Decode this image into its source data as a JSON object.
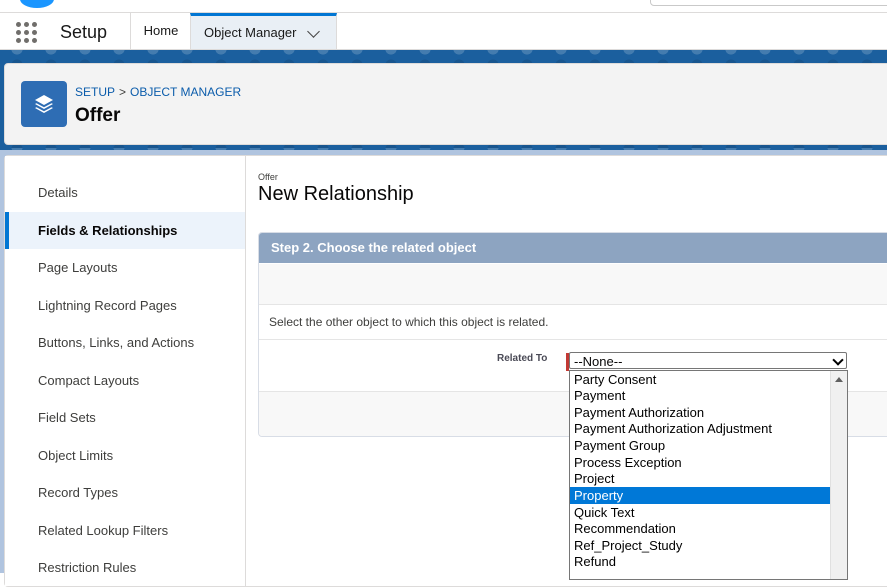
{
  "header": {
    "app_name": "Setup",
    "tabs": [
      {
        "label": "Home"
      },
      {
        "label": "Object Manager"
      }
    ]
  },
  "page_header": {
    "breadcrumb": [
      "SETUP",
      "OBJECT MANAGER"
    ],
    "breadcrumb_separator": ">",
    "title": "Offer"
  },
  "sidebar": {
    "items": [
      {
        "label": "Details"
      },
      {
        "label": "Fields & Relationships"
      },
      {
        "label": "Page Layouts"
      },
      {
        "label": "Lightning Record Pages"
      },
      {
        "label": "Buttons, Links, and Actions"
      },
      {
        "label": "Compact Layouts"
      },
      {
        "label": "Field Sets"
      },
      {
        "label": "Object Limits"
      },
      {
        "label": "Record Types"
      },
      {
        "label": "Related Lookup Filters"
      },
      {
        "label": "Restriction Rules"
      }
    ],
    "active_item": "Fields & Relationships"
  },
  "content": {
    "object_label": "Offer",
    "title": "New Relationship",
    "step_header": "Step 2. Choose the related object",
    "description": "Select the other object to which this object is related.",
    "field_label": "Related To",
    "select_value": "--None--",
    "options": [
      "Party Consent",
      "Payment",
      "Payment Authorization",
      "Payment Authorization Adjustment",
      "Payment Group",
      "Process Exception",
      "Project",
      "Property",
      "Quick Text",
      "Recommendation",
      "Ref_Project_Study",
      "Refund"
    ],
    "highlighted_option": "Property"
  },
  "colors": {
    "brand_blue": "#0176d3",
    "header_band": "#1b5f9e",
    "step_header_bg": "#8da4c1",
    "selected_option_bg": "#0078d7",
    "required_marker": "#c23934"
  },
  "icons": {
    "app_launcher": "waffle-grid-icon",
    "object_icon": "layers-stack-icon",
    "tab_menu": "chevron-down-icon",
    "select_arrow": "chevron-down-icon",
    "scroll_up": "triangle-up-icon"
  }
}
